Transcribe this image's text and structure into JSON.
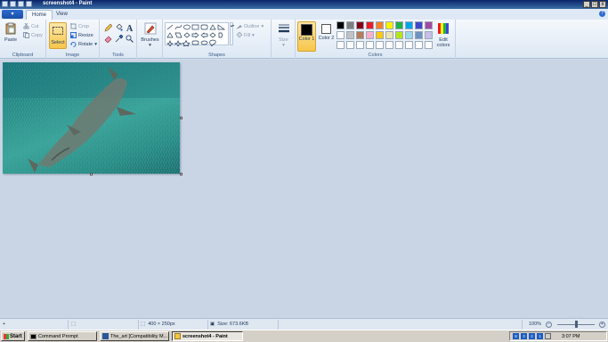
{
  "window": {
    "title": "screenshot4 - Paint",
    "minimize": "_",
    "maximize": "□",
    "close": "x"
  },
  "tabs": {
    "menu_label": "▾",
    "home": "Home",
    "view": "View",
    "help": "?"
  },
  "ribbon": {
    "clipboard": {
      "label": "Clipboard",
      "paste": "Paste",
      "cut": "Cut",
      "copy": "Copy"
    },
    "image": {
      "label": "Image",
      "select": "Select",
      "crop": "Crop",
      "resize": "Resize",
      "rotate": "Rotate"
    },
    "tools": {
      "label": "Tools"
    },
    "brushes": {
      "label": "Brushes"
    },
    "shapes": {
      "label": "Shapes",
      "outline": "Outline",
      "fill": "Fill"
    },
    "size": {
      "label": "Size"
    },
    "colors": {
      "label": "Colors",
      "color1": "Color 1",
      "color2": "Color 2",
      "edit": "Edit colors",
      "color1_value": "#000000",
      "color2_value": "#ffffff",
      "palette_row1": [
        "#000000",
        "#7f7f7f",
        "#880015",
        "#ed1c24",
        "#ff7f27",
        "#fff200",
        "#22b14c",
        "#00a2e8",
        "#3f48cc",
        "#a349a4"
      ],
      "palette_row2": [
        "#ffffff",
        "#c3c3c3",
        "#b97a57",
        "#ffaec9",
        "#ffc90e",
        "#efe4b0",
        "#b5e61d",
        "#99d9ea",
        "#7092be",
        "#c8bfe7"
      ],
      "palette_row3": [
        "#ffffff",
        "#ffffff",
        "#ffffff",
        "#ffffff",
        "#ffffff",
        "#ffffff",
        "#ffffff",
        "#ffffff",
        "#ffffff",
        "#ffffff"
      ]
    }
  },
  "status": {
    "dimensions": "400 × 250px",
    "size": "Size: 673.6KB",
    "zoom": "100%",
    "zoom_out": "−",
    "zoom_in": "+"
  },
  "taskbar": {
    "start": "Start",
    "tasks": [
      {
        "label": "Command Prompt"
      },
      {
        "label": "The_art [Compatibility M..."
      },
      {
        "label": "screenshot4 - Paint"
      }
    ],
    "tray_icons": [
      "S",
      "3",
      "2",
      "1"
    ],
    "clock": "3:07 PM"
  }
}
